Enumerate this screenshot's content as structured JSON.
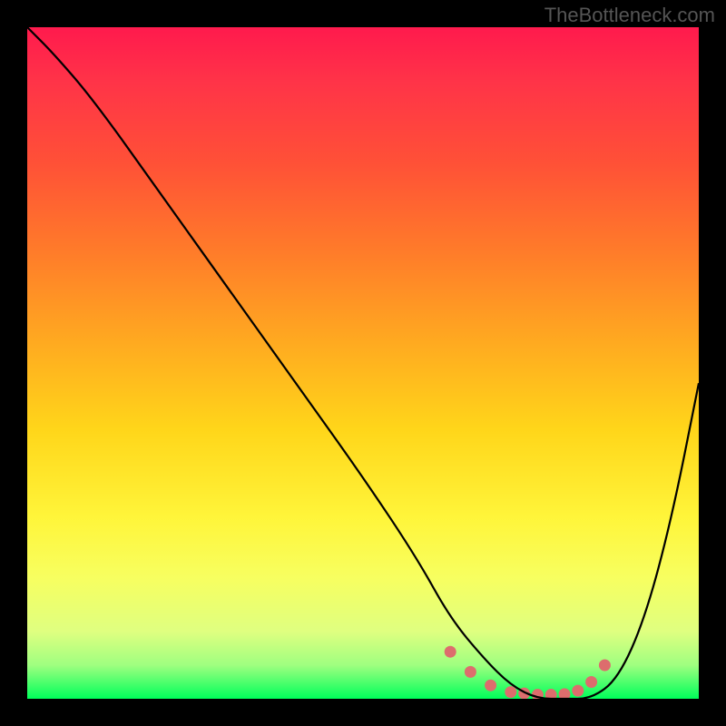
{
  "watermark": "TheBottleneck.com",
  "chart_data": {
    "type": "line",
    "title": "",
    "xlabel": "",
    "ylabel": "",
    "xlim": [
      0,
      100
    ],
    "ylim": [
      0,
      100
    ],
    "grid": false,
    "legend": false,
    "gradient_stops": [
      {
        "pos": 0,
        "color": "#ff1a4d"
      },
      {
        "pos": 8,
        "color": "#ff3348"
      },
      {
        "pos": 20,
        "color": "#ff5037"
      },
      {
        "pos": 33,
        "color": "#ff7a2a"
      },
      {
        "pos": 47,
        "color": "#ffaa20"
      },
      {
        "pos": 60,
        "color": "#ffd61a"
      },
      {
        "pos": 73,
        "color": "#fff53a"
      },
      {
        "pos": 82,
        "color": "#f7ff60"
      },
      {
        "pos": 90,
        "color": "#dfff80"
      },
      {
        "pos": 95,
        "color": "#9fff80"
      },
      {
        "pos": 100,
        "color": "#00ff5a"
      }
    ],
    "series": [
      {
        "name": "bottleneck-curve",
        "color": "#000000",
        "x": [
          0,
          4,
          10,
          20,
          30,
          40,
          50,
          58,
          63,
          68,
          72,
          76,
          80,
          84,
          88,
          92,
          96,
          100
        ],
        "y": [
          100,
          96,
          89,
          75,
          61,
          47,
          33,
          21,
          12,
          6,
          2,
          0,
          0,
          0,
          3,
          12,
          27,
          47
        ]
      }
    ],
    "markers": {
      "name": "bottom-dots",
      "color": "#dd6d6d",
      "x": [
        63,
        66,
        69,
        72,
        74,
        76,
        78,
        80,
        82,
        84,
        86
      ],
      "y": [
        7,
        4,
        2,
        1,
        0.8,
        0.6,
        0.6,
        0.7,
        1.2,
        2.5,
        5
      ]
    }
  }
}
